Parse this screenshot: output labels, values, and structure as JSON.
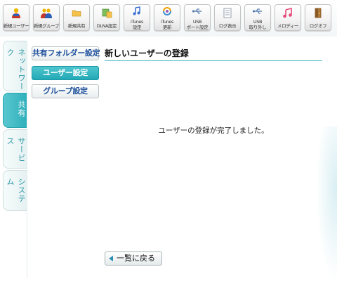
{
  "toolbar": {
    "buttons": [
      {
        "label": "新規ユーザー",
        "icon": "single-user-icon"
      },
      {
        "label": "新規グループ",
        "icon": "group-users-icon"
      },
      {
        "label": "新規共有",
        "icon": "folder-icon"
      },
      {
        "label": "DLNA設定",
        "icon": "media-server-icon"
      },
      {
        "label": "iTunes\n設定",
        "icon": "music-note-icon"
      },
      {
        "label": "iTunes\n更新",
        "icon": "music-update-icon"
      },
      {
        "label": "USB\nポート設定",
        "icon": "usb-icon"
      },
      {
        "label": "ログ表示",
        "icon": "log-document-icon"
      },
      {
        "label": "USB\n取り外し",
        "icon": "usb-remove-icon"
      },
      {
        "label": "メロディー",
        "icon": "melody-icon"
      },
      {
        "label": "ログオフ",
        "icon": "logoff-door-icon"
      }
    ]
  },
  "side_tabs": [
    {
      "label": "ネットワーク",
      "active": false
    },
    {
      "label": "共有",
      "active": true
    },
    {
      "label": "サービス",
      "active": false
    },
    {
      "label": "システム",
      "active": false
    }
  ],
  "menu": {
    "shared_folder": "共有フォルダー設定",
    "user": "ユーザー設定",
    "group": "グループ設定"
  },
  "page": {
    "title": "新しいユーザーの登録",
    "message": "ユーザーの登録が完了しました。",
    "back_label": "一覧に戻る"
  },
  "colors": {
    "accent": "#2fb0bb",
    "link_text": "#1d4f9b"
  }
}
